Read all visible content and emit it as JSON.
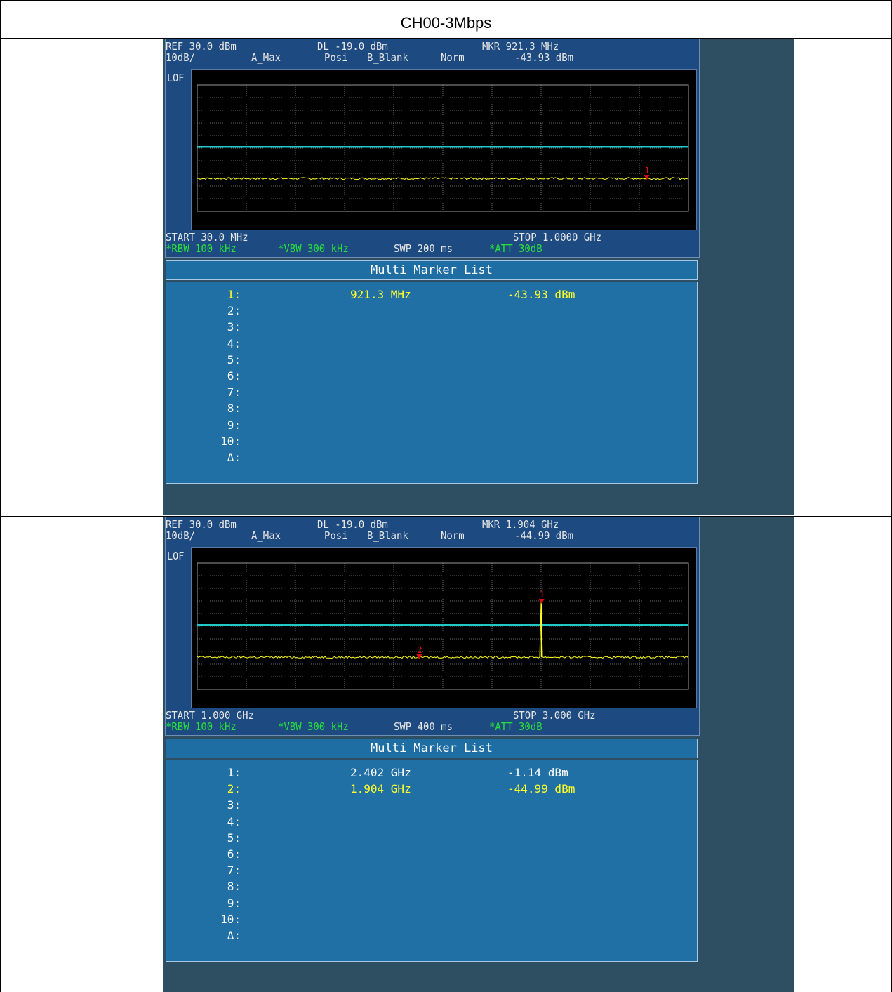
{
  "report_title": "CH00-3Mbps",
  "screens": [
    {
      "header": {
        "ref": "REF 30.0 dBm",
        "scale": "10dB/",
        "trace_mode": "A_Max",
        "dl": "DL -19.0 dBm",
        "detector": "Posi",
        "trace_b": "B_Blank",
        "mode": "Norm",
        "mkr_freq": "MKR 921.3 MHz",
        "mkr_level": "-43.93 dBm",
        "lof": "LOF",
        "start": "START 30.0 MHz",
        "stop": "STOP 1.0000 GHz",
        "rbw": "*RBW 100 kHz",
        "vbw": "*VBW 300 kHz",
        "swp": "SWP 200 ms",
        "att": "*ATT 30dB"
      },
      "marker_list_title": "Multi Marker List",
      "markers": [
        {
          "n": "1:",
          "freq": "921.3 MHz",
          "level": "-43.93 dBm",
          "selected": true
        },
        {
          "n": "2:",
          "freq": "",
          "level": ""
        },
        {
          "n": "3:",
          "freq": "",
          "level": ""
        },
        {
          "n": "4:",
          "freq": "",
          "level": ""
        },
        {
          "n": "5:",
          "freq": "",
          "level": ""
        },
        {
          "n": "6:",
          "freq": "",
          "level": ""
        },
        {
          "n": "7:",
          "freq": "",
          "level": ""
        },
        {
          "n": "8:",
          "freq": "",
          "level": ""
        },
        {
          "n": "9:",
          "freq": "",
          "level": ""
        },
        {
          "n": "10:",
          "freq": "",
          "level": ""
        },
        {
          "n": "Δ:",
          "freq": "",
          "level": ""
        }
      ],
      "trace": {
        "ref_level_dbm": 30,
        "db_per_div": 10,
        "display_line_dbm": -19,
        "noise_floor_dbm": -44,
        "spikes": [],
        "plot_markers": [
          {
            "label": "1",
            "freq_fraction": 0.915,
            "level_dbm": -43.93
          }
        ]
      },
      "colors": {
        "trace": "#ffff20",
        "display_line": "#20c8c8",
        "marker": "#e01010"
      }
    },
    {
      "header": {
        "ref": "REF 30.0 dBm",
        "scale": "10dB/",
        "trace_mode": "A_Max",
        "dl": "DL -19.0 dBm",
        "detector": "Posi",
        "trace_b": "B_Blank",
        "mode": "Norm",
        "mkr_freq": "MKR 1.904 GHz",
        "mkr_level": "-44.99 dBm",
        "lof": "LOF",
        "start": "START 1.000 GHz",
        "stop": "STOP 3.000 GHz",
        "rbw": "*RBW 100 kHz",
        "vbw": "*VBW 300 kHz",
        "swp": "SWP 400 ms",
        "att": "*ATT 30dB"
      },
      "marker_list_title": "Multi Marker List",
      "markers": [
        {
          "n": "1:",
          "freq": "2.402 GHz",
          "level": "-1.14 dBm"
        },
        {
          "n": "2:",
          "freq": "1.904 GHz",
          "level": "-44.99 dBm",
          "selected": true
        },
        {
          "n": "3:",
          "freq": "",
          "level": ""
        },
        {
          "n": "4:",
          "freq": "",
          "level": ""
        },
        {
          "n": "5:",
          "freq": "",
          "level": ""
        },
        {
          "n": "6:",
          "freq": "",
          "level": ""
        },
        {
          "n": "7:",
          "freq": "",
          "level": ""
        },
        {
          "n": "8:",
          "freq": "",
          "level": ""
        },
        {
          "n": "9:",
          "freq": "",
          "level": ""
        },
        {
          "n": "10:",
          "freq": "",
          "level": ""
        },
        {
          "n": "Δ:",
          "freq": "",
          "level": ""
        }
      ],
      "trace": {
        "ref_level_dbm": 30,
        "db_per_div": 10,
        "display_line_dbm": -19,
        "noise_floor_dbm": -44.5,
        "spikes": [
          {
            "freq_fraction": 0.701,
            "level_dbm": -1.14
          }
        ],
        "plot_markers": [
          {
            "label": "1",
            "freq_fraction": 0.701,
            "level_dbm": -1.14
          },
          {
            "label": "2",
            "freq_fraction": 0.452,
            "level_dbm": -44.99
          }
        ]
      },
      "colors": {
        "trace": "#ffff20",
        "display_line": "#20c8c8",
        "marker": "#e01010"
      }
    }
  ]
}
